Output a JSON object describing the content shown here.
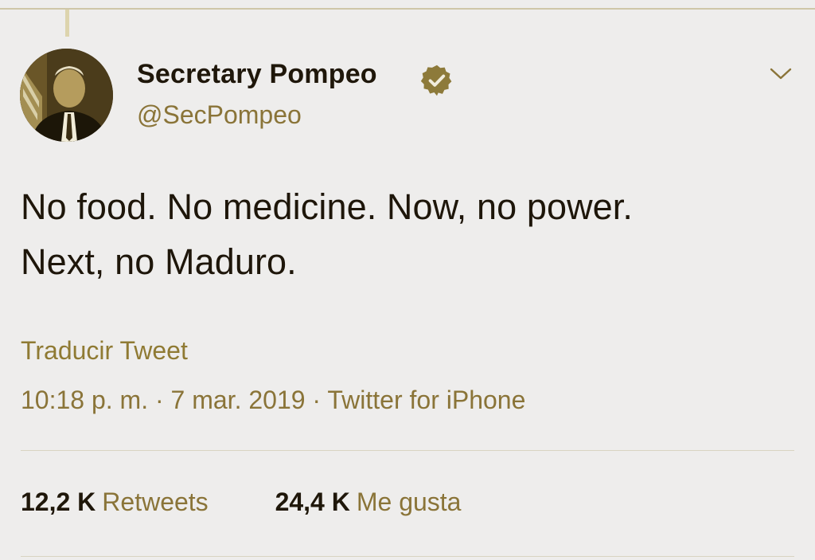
{
  "tweet": {
    "display_name": "Secretary Pompeo",
    "handle": "@SecPompeo",
    "text_lines": [
      "No food. No medicine. Now, no power.",
      "Next, no Maduro."
    ],
    "translate_label": "Traducir Tweet",
    "time": "10:18 p. m.",
    "separator": "·",
    "date": "7 mar. 2019",
    "source": "Twitter for iPhone",
    "stats": [
      {
        "count": "12,2 K",
        "label": "Retweets"
      },
      {
        "count": "24,4 K",
        "label": "Me gusta"
      }
    ],
    "icons": {
      "verified": "verified-badge-icon",
      "menu": "chevron-down-icon"
    }
  },
  "colors": {
    "background": "#eeedec",
    "text": "#1f170a",
    "muted": "#8a7438",
    "accent": "#8f7a33",
    "verified_badge": "#8d7a3a"
  }
}
